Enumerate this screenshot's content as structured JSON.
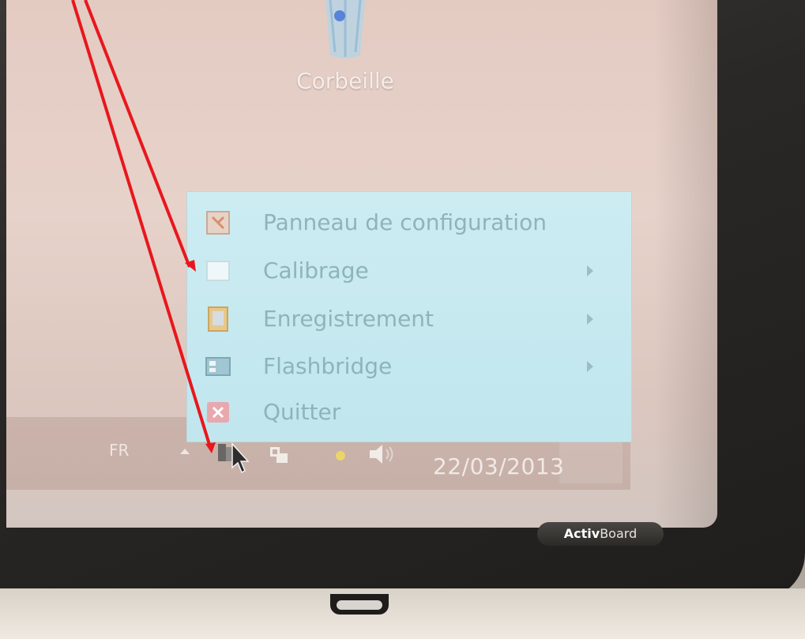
{
  "desktop": {
    "recycle_bin_label": "Corbeille",
    "recycle_bin_icon": "recycle-bin-icon"
  },
  "context_menu": {
    "items": [
      {
        "label": "Panneau de configuration",
        "icon": "control-panel-icon",
        "has_submenu": false
      },
      {
        "label": "Calibrage",
        "icon": "calibration-icon",
        "has_submenu": true
      },
      {
        "label": "Enregistrement",
        "icon": "registration-icon",
        "has_submenu": true
      },
      {
        "label": "Flashbridge",
        "icon": "flashbridge-icon",
        "has_submenu": true
      },
      {
        "label": "Quitter",
        "icon": "quit-icon",
        "has_submenu": false
      }
    ],
    "background_color": "#c6e8ef",
    "text_color": "#8fb4b8"
  },
  "taskbar": {
    "language": "FR",
    "date": "22/03/2013",
    "tray_icons": [
      "show-hidden-icons-icon",
      "activboard-tray-icon",
      "network-icon",
      "notification-icon",
      "volume-icon"
    ]
  },
  "device": {
    "brand_prefix": "Activ",
    "brand_suffix": "Board"
  },
  "annotation": {
    "arrow_color": "#e8171d",
    "arrow_count": 2
  }
}
